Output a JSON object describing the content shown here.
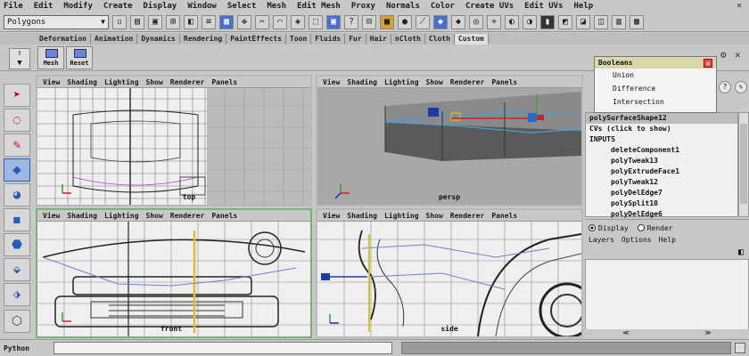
{
  "menubar": [
    "File",
    "Edit",
    "Modify",
    "Create",
    "Display",
    "Window",
    "Select",
    "Mesh",
    "Edit Mesh",
    "Proxy",
    "Normals",
    "Color",
    "Create UVs",
    "Edit UVs",
    "Help"
  ],
  "status": {
    "mode_value": "Polygons"
  },
  "shelf": {
    "tabs": [
      "Deformation",
      "Animation",
      "Dynamics",
      "Rendering",
      "PaintEffects",
      "Toon",
      "Fluids",
      "Fur",
      "Hair",
      "nCloth",
      "Cloth",
      "Custom"
    ],
    "active_tab": "Custom",
    "buttons": [
      {
        "label": "Mesh"
      },
      {
        "label": "Reset"
      }
    ]
  },
  "viewport_menu": [
    "View",
    "Shading",
    "Lighting",
    "Show",
    "Renderer",
    "Panels"
  ],
  "viewports": {
    "top_left": {
      "camera": "top"
    },
    "top_right": {
      "camera": "persp"
    },
    "bottom_left": {
      "camera": "front"
    },
    "bottom_right": {
      "camera": "side"
    }
  },
  "boolean_window": {
    "title": "Booleans",
    "items": [
      "Union",
      "Difference",
      "Intersection"
    ]
  },
  "channel_box": {
    "rows": [
      {
        "text": "polySurfaceShape12",
        "indent": false,
        "selected": true
      },
      {
        "text": "CVs (click to show)",
        "indent": false,
        "selected": false
      },
      {
        "text": "INPUTS",
        "indent": false,
        "selected": false
      },
      {
        "text": "deleteComponent1",
        "indent": true,
        "selected": false
      },
      {
        "text": "polyTweak13",
        "indent": true,
        "selected": false
      },
      {
        "text": "polyExtrudeFace1",
        "indent": true,
        "selected": false
      },
      {
        "text": "polyTweak12",
        "indent": true,
        "selected": false
      },
      {
        "text": "polyDelEdge7",
        "indent": true,
        "selected": false
      },
      {
        "text": "polySplit10",
        "indent": true,
        "selected": false
      },
      {
        "text": "polyDelEdge6",
        "indent": true,
        "selected": false
      }
    ]
  },
  "layer_editor": {
    "display_label": "Display",
    "render_label": "Render",
    "menu": [
      "Layers",
      "Options",
      "Help"
    ]
  },
  "command_line": {
    "language": "Python"
  },
  "colors": {
    "active_viewport_border": "#7ab07a",
    "shaded_face": "#5a5a5a",
    "selected_wire": "#4aa0d8"
  }
}
